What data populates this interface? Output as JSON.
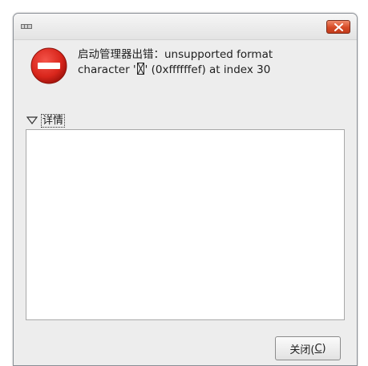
{
  "window": {
    "close_icon": "close-x-icon",
    "app_icon": "app-icon"
  },
  "error": {
    "icon": "error-stop-icon",
    "line1": "启动管理器出错：unsupported format",
    "line2_prefix": "character '",
    "line2_suffix": "' (0xffffffef) at index 30"
  },
  "details": {
    "expander_label": "详情",
    "expanded": true,
    "content": ""
  },
  "buttons": {
    "close_label_prefix": "关闭(",
    "close_label_mnemonic": "C",
    "close_label_suffix": ")"
  },
  "colors": {
    "error_red": "#d9261c",
    "title_close_red": "#d64a26"
  }
}
